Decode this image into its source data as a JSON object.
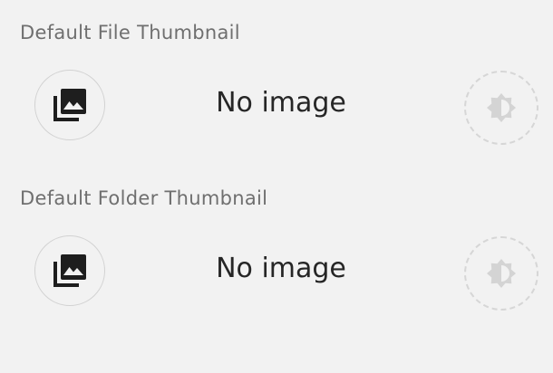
{
  "file_thumbnail": {
    "label": "Default File Thumbnail",
    "pick_icon": "image-gallery-icon",
    "status": "No image",
    "toggle_icon": "brightness-icon"
  },
  "folder_thumbnail": {
    "label": "Default Folder Thumbnail",
    "pick_icon": "image-gallery-icon",
    "status": "No image",
    "toggle_icon": "brightness-icon"
  },
  "colors": {
    "background": "#f2f2f2",
    "label": "#6f6f6f",
    "text": "#262626",
    "icon": "#1e1e1e",
    "border": "#d2d2d2",
    "disabled_icon": "#d4d4d4"
  }
}
